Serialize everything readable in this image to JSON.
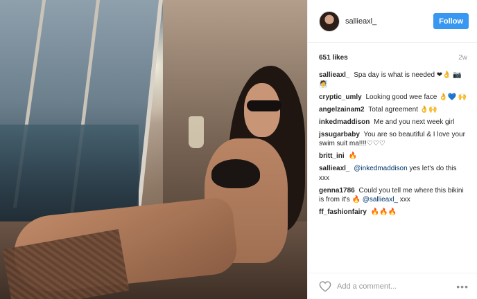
{
  "post": {
    "username": "sallieaxl_",
    "follow_label": "Follow",
    "likes": "651 likes",
    "age": "2w"
  },
  "comments": [
    {
      "author": "sallieaxl_",
      "text": "Spa day is what is needed ❤👌 📷🧖"
    },
    {
      "author": "cryptic_umly",
      "text": "Looking good wee face 👌💙 🙌"
    },
    {
      "author": "angelzainam2",
      "text": "Total agreement 👌🙌"
    },
    {
      "author": "inkedmaddison",
      "text": "Me and you next week girl"
    },
    {
      "author": "jssugarbaby",
      "text": "You are so beautiful & I love your swim suit ma!!!!♡♡♡"
    },
    {
      "author": "britt_ini",
      "text": "🔥"
    },
    {
      "author": "sallieaxl_",
      "mention": "@inkedmaddison",
      "text": "yes let's do this xxx"
    },
    {
      "author": "genna1786",
      "text": "Could you tell me where this bikini is from it's 🔥",
      "mention": "@sallieaxl_",
      "text_after": "xxx"
    },
    {
      "author": "ff_fashionfairy",
      "text": "🔥🔥🔥"
    }
  ],
  "add_comment": {
    "placeholder": "Add a comment..."
  },
  "more_label": "•••",
  "colors": {
    "follow_button": "#3897f0",
    "mention": "#003569",
    "muted": "#999999"
  },
  "icons": {
    "like": "heart-outline-icon",
    "options": "more-options-icon"
  }
}
